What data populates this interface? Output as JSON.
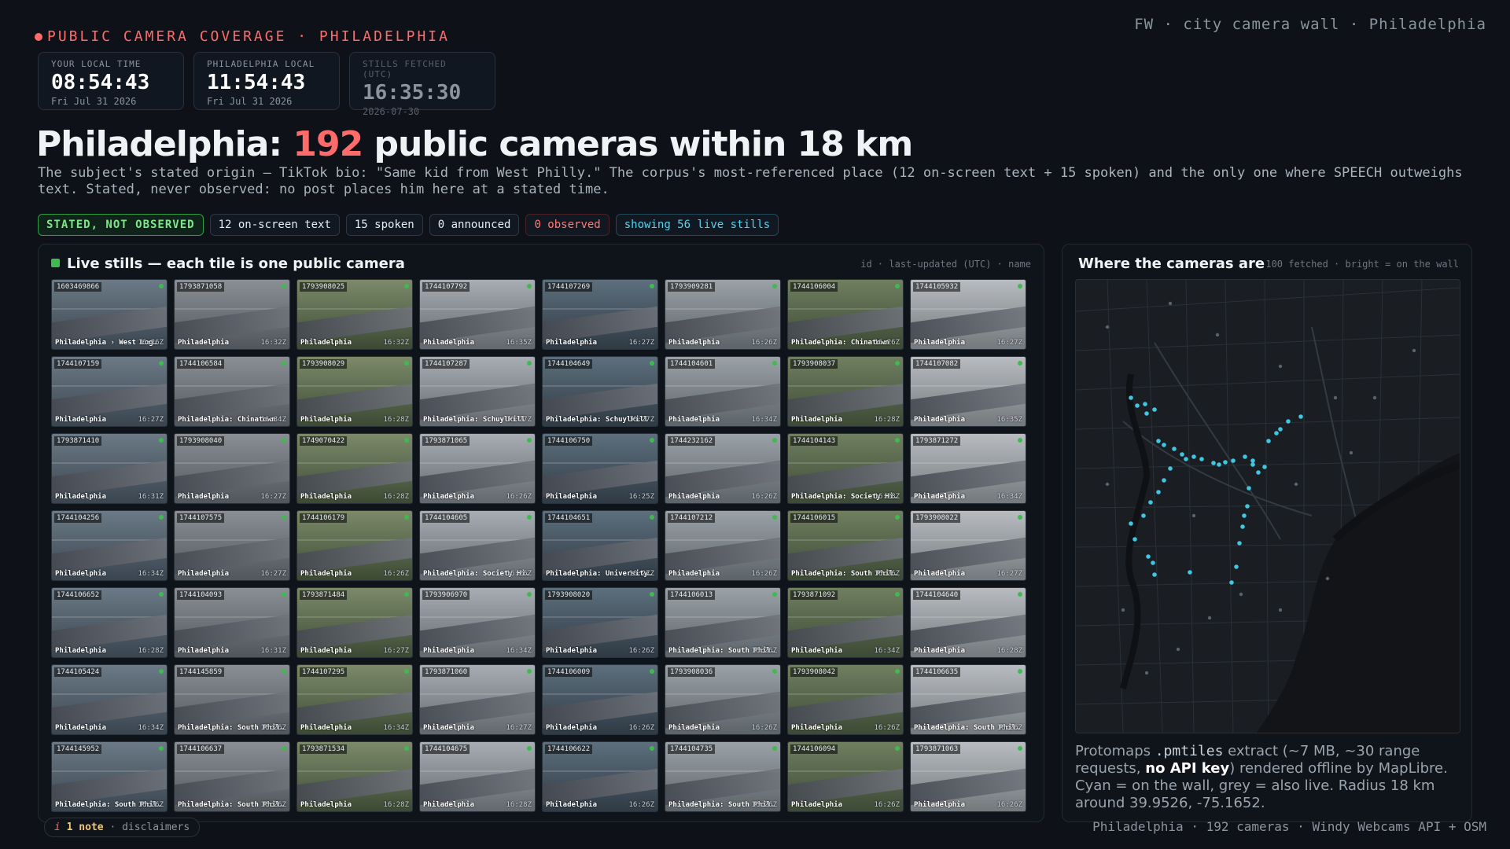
{
  "kicker": "PUBLIC CAMERA COVERAGE · PHILADELPHIA",
  "brand": "FW · city camera wall · Philadelphia",
  "clocks": [
    {
      "label": "YOUR LOCAL TIME",
      "time": "08:54:43",
      "date": "Fri Jul 31 2026"
    },
    {
      "label": "PHILADELPHIA LOCAL",
      "time": "11:54:43",
      "date": "Fri Jul 31 2026"
    },
    {
      "label": "STILLS FETCHED (UTC)",
      "time": "16:35:30",
      "date": "2026-07-30"
    }
  ],
  "headline": {
    "pre": "Philadelphia: ",
    "count": "192",
    "post": " public cameras within 18 km"
  },
  "lede": "The subject's stated origin — TikTok bio: \"Same kid from West Philly.\" The corpus's most-referenced place (12 on-screen text + 15 spoken) and the only one where SPEECH outweighs text. Stated, never observed: no post places him here at a stated time.",
  "chips": [
    "STATED, NOT OBSERVED",
    "12 on-screen text",
    "15 spoken",
    "0 announced",
    "0 observed",
    "showing 56 live stills"
  ],
  "stills_panel": {
    "title": "Live stills — each tile is one public camera",
    "meta": "id · last-updated (UTC) · name"
  },
  "tiles": [
    {
      "id": "1603469866",
      "name": "Philadelphia › West Log…",
      "ts": "16:26Z"
    },
    {
      "id": "1793871058",
      "name": "Philadelphia",
      "ts": "16:32Z"
    },
    {
      "id": "1793908025",
      "name": "Philadelphia",
      "ts": "16:32Z"
    },
    {
      "id": "1744107792",
      "name": "Philadelphia",
      "ts": "16:35Z"
    },
    {
      "id": "1744107269",
      "name": "Philadelphia",
      "ts": "16:27Z"
    },
    {
      "id": "1793909281",
      "name": "Philadelphia",
      "ts": "16:26Z"
    },
    {
      "id": "1744106004",
      "name": "Philadelphia: Chinatown",
      "ts": "16:26Z"
    },
    {
      "id": "1744105932",
      "name": "Philadelphia",
      "ts": "16:27Z"
    },
    {
      "id": "1744107159",
      "name": "Philadelphia",
      "ts": "16:27Z"
    },
    {
      "id": "1744106584",
      "name": "Philadelphia: Chinatown",
      "ts": "16:34Z"
    },
    {
      "id": "1793908029",
      "name": "Philadelphia",
      "ts": "16:28Z"
    },
    {
      "id": "1744107287",
      "name": "Philadelphia: Schuylkill",
      "ts": "16:27Z"
    },
    {
      "id": "1744104649",
      "name": "Philadelphia: Schuylkill",
      "ts": "16:27Z"
    },
    {
      "id": "1744104601",
      "name": "Philadelphia",
      "ts": "16:34Z"
    },
    {
      "id": "1793908037",
      "name": "Philadelphia",
      "ts": "16:28Z"
    },
    {
      "id": "1744107082",
      "name": "Philadelphia",
      "ts": "16:35Z"
    },
    {
      "id": "1793871410",
      "name": "Philadelphia",
      "ts": "16:31Z"
    },
    {
      "id": "1793908040",
      "name": "Philadelphia",
      "ts": "16:27Z"
    },
    {
      "id": "1749070422",
      "name": "Philadelphia",
      "ts": "16:28Z"
    },
    {
      "id": "1793871065",
      "name": "Philadelphia",
      "ts": "16:26Z"
    },
    {
      "id": "1744106750",
      "name": "Philadelphia",
      "ts": "16:25Z"
    },
    {
      "id": "1744232162",
      "name": "Philadelphia",
      "ts": "16:26Z"
    },
    {
      "id": "1744104143",
      "name": "Philadelphia: Society Hi…",
      "ts": "16:28Z"
    },
    {
      "id": "1793871272",
      "name": "Philadelphia",
      "ts": "16:34Z"
    },
    {
      "id": "1744104256",
      "name": "Philadelphia",
      "ts": "16:34Z"
    },
    {
      "id": "1744107575",
      "name": "Philadelphia",
      "ts": "16:27Z"
    },
    {
      "id": "1744106179",
      "name": "Philadelphia",
      "ts": "16:26Z"
    },
    {
      "id": "1744104605",
      "name": "Philadelphia: Society Hi…",
      "ts": "16:26Z"
    },
    {
      "id": "1744104651",
      "name": "Philadelphia: University…",
      "ts": "16:27Z"
    },
    {
      "id": "1744107212",
      "name": "Philadelphia",
      "ts": "16:26Z"
    },
    {
      "id": "1744106015",
      "name": "Philadelphia: South Phil…",
      "ts": "16:26Z"
    },
    {
      "id": "1793908022",
      "name": "Philadelphia",
      "ts": "16:27Z"
    },
    {
      "id": "1744106652",
      "name": "Philadelphia",
      "ts": "16:28Z"
    },
    {
      "id": "1744104093",
      "name": "Philadelphia",
      "ts": "16:31Z"
    },
    {
      "id": "1793871484",
      "name": "Philadelphia",
      "ts": "16:27Z"
    },
    {
      "id": "1793906970",
      "name": "Philadelphia",
      "ts": "16:34Z"
    },
    {
      "id": "1793908020",
      "name": "Philadelphia",
      "ts": "16:26Z"
    },
    {
      "id": "1744106013",
      "name": "Philadelphia: South Phil…",
      "ts": "16:26Z"
    },
    {
      "id": "1793871092",
      "name": "Philadelphia",
      "ts": "16:34Z"
    },
    {
      "id": "1744104640",
      "name": "Philadelphia",
      "ts": "16:28Z"
    },
    {
      "id": "1744105424",
      "name": "Philadelphia",
      "ts": "16:34Z"
    },
    {
      "id": "1744145859",
      "name": "Philadelphia: South Phil…",
      "ts": "16:26Z"
    },
    {
      "id": "1744107295",
      "name": "Philadelphia",
      "ts": "16:34Z"
    },
    {
      "id": "1793871060",
      "name": "Philadelphia",
      "ts": "16:27Z"
    },
    {
      "id": "1744106009",
      "name": "Philadelphia",
      "ts": "16:26Z"
    },
    {
      "id": "1793908036",
      "name": "Philadelphia",
      "ts": "16:26Z"
    },
    {
      "id": "1793908042",
      "name": "Philadelphia",
      "ts": "16:26Z"
    },
    {
      "id": "1744106635",
      "name": "Philadelphia: South Phil…",
      "ts": "16:26Z"
    },
    {
      "id": "1744145952",
      "name": "Philadelphia: South Phil…",
      "ts": "16:26Z"
    },
    {
      "id": "1744106637",
      "name": "Philadelphia: South Phil…",
      "ts": "16:26Z"
    },
    {
      "id": "1793871534",
      "name": "Philadelphia",
      "ts": "16:28Z"
    },
    {
      "id": "1744104675",
      "name": "Philadelphia",
      "ts": "16:28Z"
    },
    {
      "id": "1744106622",
      "name": "Philadelphia",
      "ts": "16:26Z"
    },
    {
      "id": "1744104735",
      "name": "Philadelphia: South Phil…",
      "ts": "16:26Z"
    },
    {
      "id": "1744106094",
      "name": "Philadelphia",
      "ts": "16:26Z"
    },
    {
      "id": "1793871063",
      "name": "Philadelphia",
      "ts": "16:26Z"
    }
  ],
  "map_panel": {
    "title": "Where the cameras are",
    "meta": "100 fetched · bright = on the wall"
  },
  "map_caption": {
    "t1": "Protomaps ",
    "code": ".pmtiles",
    "t2": " extract (~7 MB, ~30 range requests, ",
    "bold": "no API key",
    "t3": ") rendered offline by MapLibre. Cyan = on the wall, grey = also live. Radius 18 km around 39.9526, -75.1652."
  },
  "note": {
    "icon": "i",
    "count": "1 note",
    "sep": " · ",
    "label": "disclaimers"
  },
  "footer": "Philadelphia · 192 cameras · Windy Webcams API + OSM",
  "colors": {
    "accent_red": "#ff6b6b",
    "accent_cyan": "#56d4ef",
    "accent_green": "#3fb950",
    "bg": "#0e1218"
  }
}
